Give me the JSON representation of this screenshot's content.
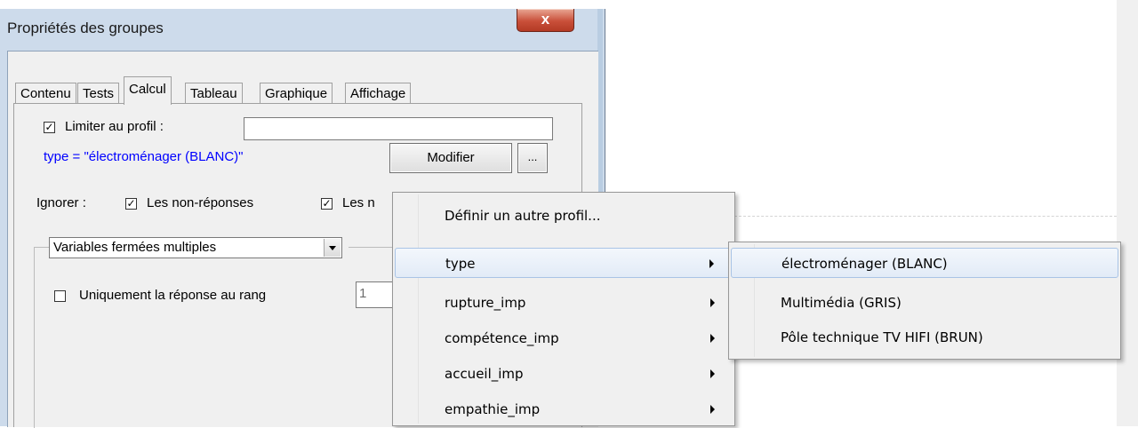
{
  "window": {
    "title": "Propriétés des groupes",
    "close_glyph": "x"
  },
  "tabs": [
    "Contenu",
    "Tests",
    "Calcul",
    "Tableau",
    "Graphique",
    "Affichage"
  ],
  "active_tab": "Calcul",
  "profile": {
    "limit_label": "Limiter au profil :",
    "limit_checked": true,
    "limit_value": "",
    "expression": "type = \"électroménager (BLANC)\"",
    "expression_color": "#0000ff",
    "modify_label": "Modifier",
    "more_label": "..."
  },
  "ignore": {
    "label": "Ignorer :",
    "nonresp_label": "Les non-réponses",
    "nonresp_checked": true,
    "second_label": "Les n",
    "second_checked": true
  },
  "variables": {
    "select_value": "Variables fermées multiples",
    "rank_label": "Uniquement la réponse au rang",
    "rank_checked": false,
    "rank_value": "1"
  },
  "context_menu": {
    "items": [
      {
        "label": "Définir un autre profil...",
        "has_submenu": false
      },
      {
        "label": "type",
        "has_submenu": true,
        "highlighted": true
      },
      {
        "label": "rupture_imp",
        "has_submenu": true
      },
      {
        "label": "compétence_imp",
        "has_submenu": true
      },
      {
        "label": "accueil_imp",
        "has_submenu": true
      },
      {
        "label": "empathie_imp",
        "has_submenu": true
      }
    ]
  },
  "submenu": {
    "items": [
      {
        "label": "électroménager (BLANC)",
        "highlighted": true
      },
      {
        "label": "Multimédia (GRIS)"
      },
      {
        "label": "Pôle technique TV HIFI (BRUN)"
      }
    ]
  },
  "colors": {
    "window_frame": "#cddbeb",
    "menu_highlight": "#e2ebf7",
    "close_button": "#c9503a"
  }
}
